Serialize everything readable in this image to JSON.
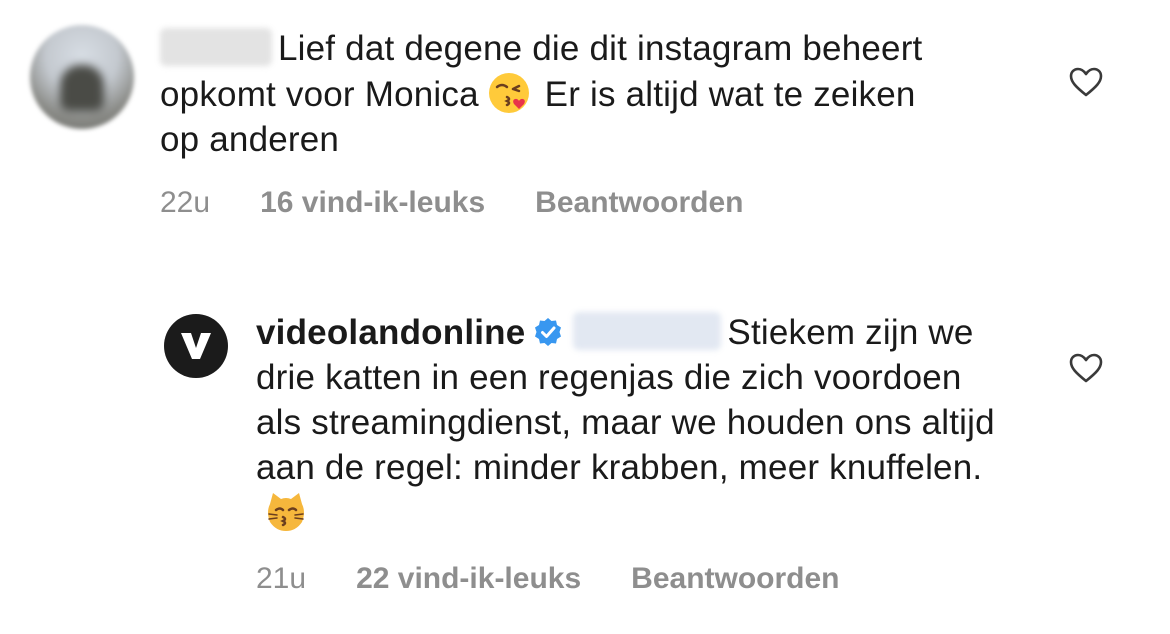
{
  "comments": [
    {
      "username": "",
      "text": "Lief dat degene die dit instagram beheert opkomt voor Monica",
      "text_after_emoji": " Er is altijd wat te zeiken op anderen",
      "emoji": "kissing-face-with-heart-emoji",
      "time": "22u",
      "likes": "16 vind-ik-leuks",
      "reply": "Beantwoorden"
    },
    {
      "username": "videolandonline",
      "verified": true,
      "avatar_letter": "V",
      "text": "Stiekem zijn we drie katten in een regenjas die zich voordoen als streamingdienst, maar we houden ons altijd aan de regel: minder krabben, meer knuffelen.",
      "emoji": "kissing-cat-emoji",
      "time": "21u",
      "likes": "22 vind-ik-leuks",
      "reply": "Beantwoorden"
    }
  ],
  "colors": {
    "text": "#1a1a1a",
    "meta": "#8e8e8e",
    "verified": "#3897f0",
    "brand_avatar": "#1b1b1b"
  }
}
